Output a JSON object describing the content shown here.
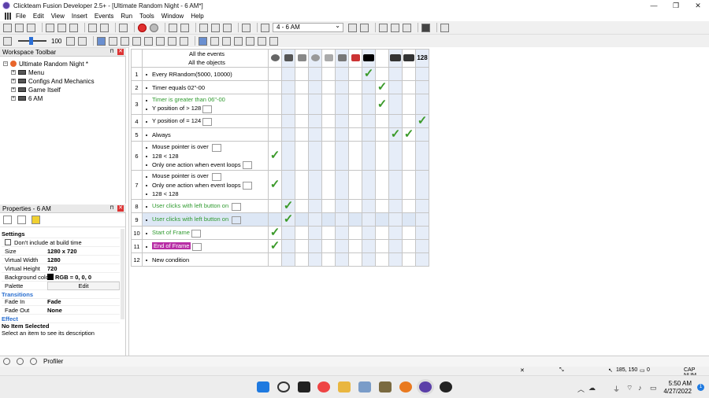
{
  "window": {
    "title": "Clickteam Fusion Developer 2.5+ - [Ultimate Random Night - 6 AM*]",
    "min": "—",
    "restore": "❐",
    "close": "✕"
  },
  "menu": [
    "File",
    "Edit",
    "View",
    "Insert",
    "Events",
    "Run",
    "Tools",
    "Window",
    "Help"
  ],
  "toolbar": {
    "frame_select": "4 - 6 AM",
    "zoom": "100"
  },
  "workspace": {
    "title": "Workspace Toolbar",
    "root": "Ultimate Random Night *",
    "items": [
      "Menu",
      "Configs And Mechanics",
      "Game Itself",
      "6 AM"
    ]
  },
  "properties": {
    "title": "Properties - 6 AM",
    "section_settings": "Settings",
    "checkbox_label": "Don't include at build time",
    "rows": [
      {
        "k": "Size",
        "v": "1280 x 720"
      },
      {
        "k": "Virtual Width",
        "v": "1280"
      },
      {
        "k": "Virtual Height",
        "v": "720"
      },
      {
        "k": "Background color",
        "v": "RGB = 0, 0, 0"
      },
      {
        "k": "Palette",
        "v": "Edit"
      }
    ],
    "section_transitions": "Transitions",
    "rows2": [
      {
        "k": "Fade In",
        "v": "Fade"
      },
      {
        "k": "Fade Out",
        "v": "None"
      }
    ],
    "section_effect": "Effect",
    "desc_title": "No Item Selected",
    "desc_text": "Select an item to see its description"
  },
  "events": {
    "header": [
      "All the events",
      "All the objects"
    ],
    "counter_label": "128",
    "rows": [
      {
        "n": "1",
        "lines": [
          "Every RRandom(5000, 10000)"
        ],
        "checks": [
          8
        ]
      },
      {
        "n": "2",
        "lines": [
          "Timer equals 02\"-00"
        ],
        "checks": [
          9
        ]
      },
      {
        "n": "3",
        "lines": [
          "Timer is greater than 06\"-00",
          "Y position of  > 128"
        ],
        "checks": [
          9
        ],
        "green0": true
      },
      {
        "n": "4",
        "lines": [
          "Y position of  = 124"
        ],
        "checks": [
          12
        ]
      },
      {
        "n": "5",
        "lines": [
          "Always"
        ],
        "checks": [
          10,
          11
        ]
      },
      {
        "n": "6",
        "lines": [
          "Mouse pointer is over ",
          "128 < 128",
          "Only one action when event loops"
        ],
        "checks": [
          1
        ]
      },
      {
        "n": "7",
        "lines": [
          "Mouse pointer is over ",
          "Only one action when event loops",
          "128 < 128"
        ],
        "checks": [
          1
        ]
      },
      {
        "n": "8",
        "lines": [
          "User clicks with left button on "
        ],
        "checks": [
          2
        ],
        "green0": true
      },
      {
        "n": "9",
        "lines": [
          "User clicks with left button on "
        ],
        "checks": [
          2
        ],
        "green0": true,
        "selected": true
      },
      {
        "n": "10",
        "lines": [
          "Start of Frame"
        ],
        "checks": [
          1
        ],
        "green0": true
      },
      {
        "n": "11",
        "lines": [
          "End of Frame"
        ],
        "checks": [
          1
        ],
        "pink": true
      },
      {
        "n": "12",
        "lines": [
          "New condition"
        ],
        "checks": []
      }
    ]
  },
  "statusbar": {
    "profiler": "Profiler",
    "coords": "185, 150",
    "count": "0",
    "caps": "CAP NUM"
  },
  "clock": {
    "time": "5:50 AM",
    "date": "4/27/2022"
  },
  "colors": {
    "accent": "#2b6fd6",
    "check": "#3b9a2a",
    "alt_col": "#e6edf8",
    "pink": "#b82ea5"
  }
}
